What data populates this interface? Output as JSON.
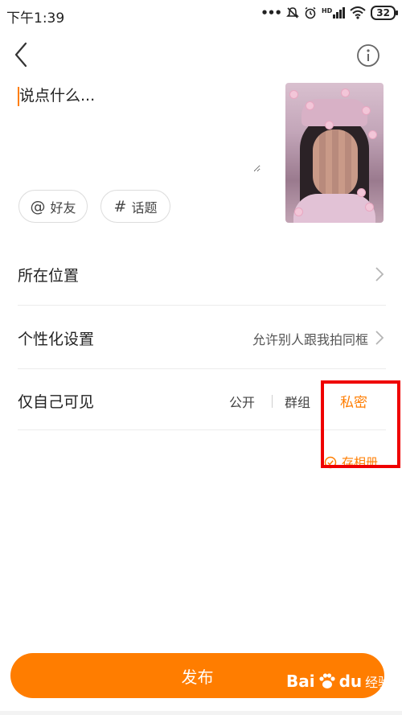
{
  "status_bar": {
    "time": "下午1:39",
    "icons": [
      "dots-icon",
      "mute-icon",
      "alarm-icon",
      "hd-signal-icon",
      "wifi-icon",
      "battery-icon"
    ],
    "hd_label": "HD",
    "battery_level": "32"
  },
  "header": {
    "back_icon": "chevron-left-icon",
    "info_icon": "info-icon"
  },
  "compose": {
    "placeholder": "说点什么..."
  },
  "chips": {
    "friends": {
      "symbol": "@",
      "label": "好友"
    },
    "topic": {
      "symbol": "#",
      "label": "话题"
    }
  },
  "rows": {
    "location": {
      "label": "所在位置"
    },
    "personalize": {
      "label": "个性化设置",
      "value": "允许别人跟我拍同框"
    },
    "visibility": {
      "label": "仅自己可见",
      "options": [
        "公开",
        "群组",
        "私密"
      ],
      "selected": "私密"
    }
  },
  "save_album": {
    "label": "存相册",
    "checked": true
  },
  "publish": {
    "label": "发布"
  },
  "watermark": {
    "brand": "Bai",
    "brand_suffix": "du",
    "sub": "经验"
  },
  "colors": {
    "accent": "#ff7d00",
    "highlight_box": "#ef0000",
    "text": "#222222",
    "divider": "#ececec"
  }
}
